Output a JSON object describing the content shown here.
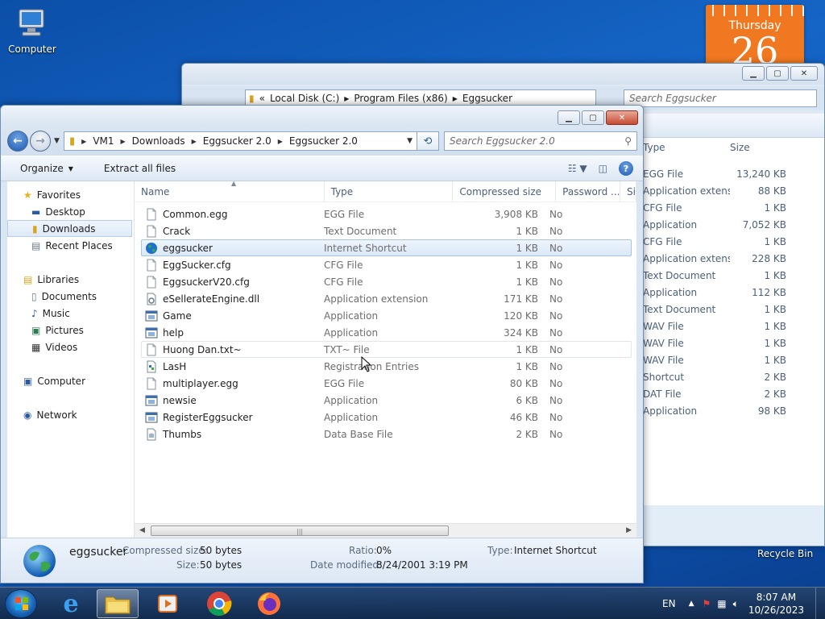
{
  "desktop": {
    "computer_label": "Computer",
    "recycle_label": "Recycle Bin",
    "calendar": {
      "day": "Thursday",
      "date": "26"
    }
  },
  "back_window": {
    "address": [
      "Local Disk (C:)",
      "Program Files (x86)",
      "Eggsucker"
    ],
    "search_placeholder": "Search Eggsucker",
    "col_type": "Type",
    "col_size": "Size",
    "rows": [
      {
        "type": "EGG File",
        "size": "13,240 KB"
      },
      {
        "type": "Application extens...",
        "size": "88 KB"
      },
      {
        "type": "CFG File",
        "size": "1 KB"
      },
      {
        "type": "Application",
        "size": "7,052 KB"
      },
      {
        "type": "CFG File",
        "size": "1 KB"
      },
      {
        "type": "Application extens...",
        "size": "228 KB"
      },
      {
        "type": "Text Document",
        "size": "1 KB"
      },
      {
        "type": "Application",
        "size": "112 KB"
      },
      {
        "type": "Text Document",
        "size": "1 KB"
      },
      {
        "type": "WAV File",
        "size": "1 KB"
      },
      {
        "type": "WAV File",
        "size": "1 KB"
      },
      {
        "type": "WAV File",
        "size": "1 KB"
      },
      {
        "type": "Shortcut",
        "size": "2 KB"
      },
      {
        "type": "DAT File",
        "size": "2 KB"
      },
      {
        "type": "Application",
        "size": "98 KB"
      }
    ]
  },
  "window": {
    "address": [
      "VM1",
      "Downloads",
      "Eggsucker 2.0",
      "Eggsucker 2.0"
    ],
    "search_placeholder": "Search Eggsucker 2.0",
    "toolbar": {
      "organize": "Organize",
      "extract": "Extract all files"
    },
    "nav": {
      "favorites": "Favorites",
      "desktop": "Desktop",
      "downloads": "Downloads",
      "recent": "Recent Places",
      "libraries": "Libraries",
      "documents": "Documents",
      "music": "Music",
      "pictures": "Pictures",
      "videos": "Videos",
      "computer": "Computer",
      "network": "Network"
    },
    "columns": {
      "name": "Name",
      "type": "Type",
      "compressed": "Compressed size",
      "password": "Password ...",
      "extra": "Si"
    },
    "files": [
      {
        "name": "Common.egg",
        "type": "EGG File",
        "size": "3,908 KB",
        "pw": "No",
        "icon": "blank-file-icon"
      },
      {
        "name": "Crack",
        "type": "Text Document",
        "size": "1 KB",
        "pw": "No",
        "icon": "text-file-icon"
      },
      {
        "name": "eggsucker",
        "type": "Internet Shortcut",
        "size": "1 KB",
        "pw": "No",
        "icon": "globe-icon"
      },
      {
        "name": "EggSucker.cfg",
        "type": "CFG File",
        "size": "1 KB",
        "pw": "No",
        "icon": "blank-file-icon"
      },
      {
        "name": "EggsuckerV20.cfg",
        "type": "CFG File",
        "size": "1 KB",
        "pw": "No",
        "icon": "blank-file-icon"
      },
      {
        "name": "eSellerateEngine.dll",
        "type": "Application extension",
        "size": "171 KB",
        "pw": "No",
        "icon": "dll-icon"
      },
      {
        "name": "Game",
        "type": "Application",
        "size": "120 KB",
        "pw": "No",
        "icon": "app-icon"
      },
      {
        "name": "help",
        "type": "Application",
        "size": "324 KB",
        "pw": "No",
        "icon": "app-icon"
      },
      {
        "name": "Huong Dan.txt~",
        "type": "TXT~ File",
        "size": "1 KB",
        "pw": "No",
        "icon": "blank-file-icon"
      },
      {
        "name": "LasH",
        "type": "Registration Entries",
        "size": "1 KB",
        "pw": "No",
        "icon": "registry-icon"
      },
      {
        "name": "multiplayer.egg",
        "type": "EGG File",
        "size": "80 KB",
        "pw": "No",
        "icon": "blank-file-icon"
      },
      {
        "name": "newsie",
        "type": "Application",
        "size": "6 KB",
        "pw": "No",
        "icon": "app-icon"
      },
      {
        "name": "RegisterEggsucker",
        "type": "Application",
        "size": "46 KB",
        "pw": "No",
        "icon": "app-icon"
      },
      {
        "name": "Thumbs",
        "type": "Data Base File",
        "size": "2 KB",
        "pw": "No",
        "icon": "database-icon"
      }
    ],
    "details": {
      "name": "eggsucker",
      "compressed_label": "Compressed size:",
      "compressed_value": "50 bytes",
      "size_label": "Size:",
      "size_value": "50 bytes",
      "ratio_label": "Ratio:",
      "ratio_value": "0%",
      "modified_label": "Date modified:",
      "modified_value": "8/24/2001 3:19 PM",
      "type_label": "Type:",
      "type_value": "Internet Shortcut"
    }
  },
  "taskbar": {
    "language": "EN",
    "time": "8:07 AM",
    "date": "10/26/2023"
  }
}
